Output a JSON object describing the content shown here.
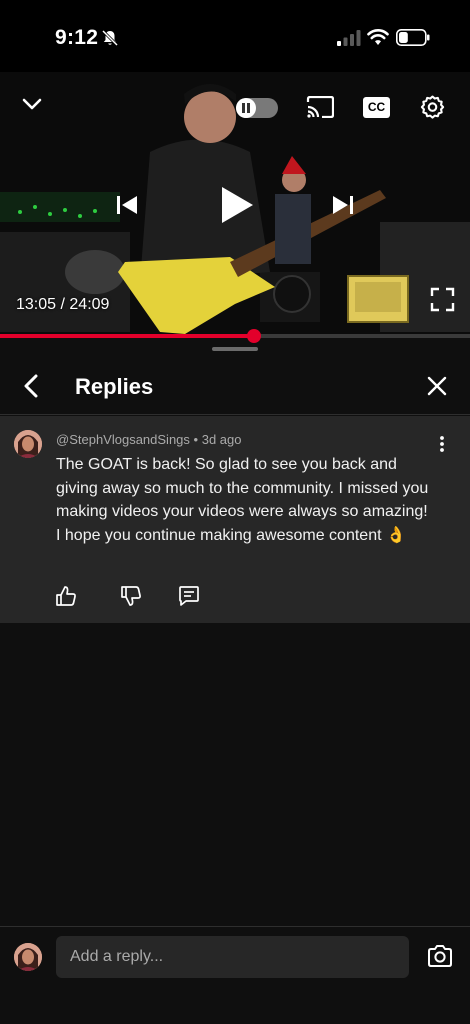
{
  "status_bar": {
    "time": "9:12",
    "battery_level": 0.35
  },
  "player": {
    "time_current": "13:05",
    "time_separator": "/",
    "time_total": "24:09",
    "progress": 0.54,
    "accent_color": "#e3002b",
    "icons": [
      "collapse-chevron-icon",
      "pause-icon",
      "cast-icon",
      "captions-icon",
      "settings-gear-icon",
      "previous-icon",
      "play-icon",
      "next-icon",
      "fullscreen-icon"
    ],
    "captions_label": "CC"
  },
  "replies_panel": {
    "title": "Replies"
  },
  "comment": {
    "author": "@StephVlogsandSings",
    "separator": "•",
    "age": "3d ago",
    "text": "The GOAT is back! So glad to see you back and giving away so much to the community. I missed you making videos your videos were always so amazing! I hope you continue making awesome content 👌"
  },
  "composer": {
    "placeholder": "Add a reply..."
  },
  "colors": {
    "background": "#0f0f0f",
    "card": "#272727",
    "secondary_text": "#aaaaaa"
  }
}
